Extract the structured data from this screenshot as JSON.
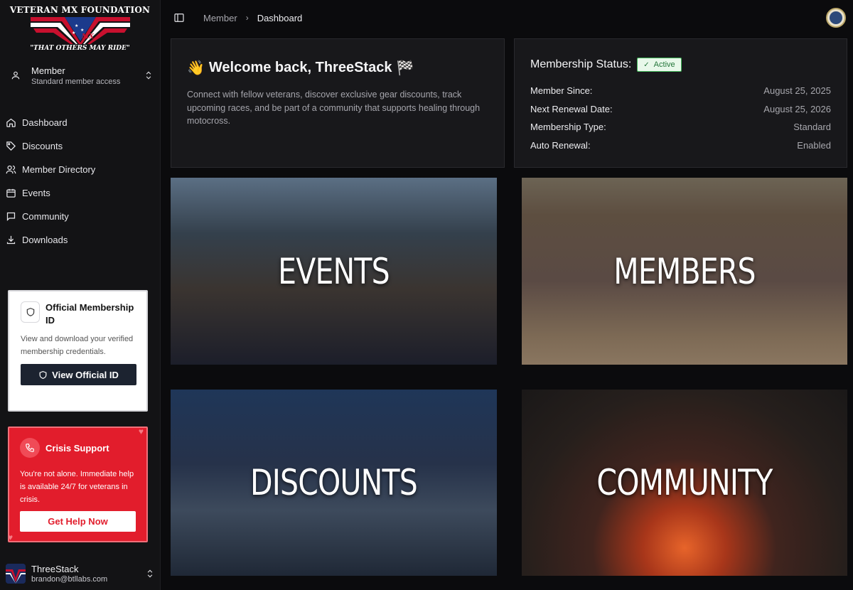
{
  "brand": {
    "title": "VETERAN MX FOUNDATION",
    "tagline": "\"THAT OTHERS MAY RIDE\"",
    "logo_mark": "MX"
  },
  "role": {
    "name": "Member",
    "access": "Standard member access"
  },
  "nav": [
    {
      "label": "Dashboard",
      "icon": "home-icon"
    },
    {
      "label": "Discounts",
      "icon": "tag-icon"
    },
    {
      "label": "Member Directory",
      "icon": "users-icon"
    },
    {
      "label": "Events",
      "icon": "calendar-icon"
    },
    {
      "label": "Community",
      "icon": "message-icon"
    },
    {
      "label": "Downloads",
      "icon": "download-icon"
    }
  ],
  "id_card": {
    "title": "Official Membership ID",
    "description": "View and download your verified membership credentials.",
    "button": "View Official ID"
  },
  "crisis": {
    "title": "Crisis Support",
    "description": "You're not alone. Immediate help is available 24/7 for veterans in crisis.",
    "button": "Get Help Now"
  },
  "user": {
    "name": "ThreeStack",
    "email": "brandon@btllabs.com"
  },
  "breadcrumb": {
    "parent": "Member",
    "current": "Dashboard"
  },
  "welcome": {
    "wave": "👋",
    "title": "Welcome back, ThreeStack",
    "flag": "🏁",
    "body": "Connect with fellow veterans, discover exclusive gear discounts, track upcoming races, and be part of a community that supports healing through motocross."
  },
  "status": {
    "title": "Membership Status:",
    "badge": "Active",
    "rows": [
      {
        "key": "Member Since:",
        "value": "August 25, 2025"
      },
      {
        "key": "Next Renewal Date:",
        "value": "August 25, 2026"
      },
      {
        "key": "Membership Type:",
        "value": "Standard"
      },
      {
        "key": "Auto Renewal:",
        "value": "Enabled"
      }
    ]
  },
  "tiles": {
    "events": "EVENTS",
    "members": "MEMBERS",
    "discounts": "DISCOUNTS",
    "community": "COMMUNITY"
  }
}
